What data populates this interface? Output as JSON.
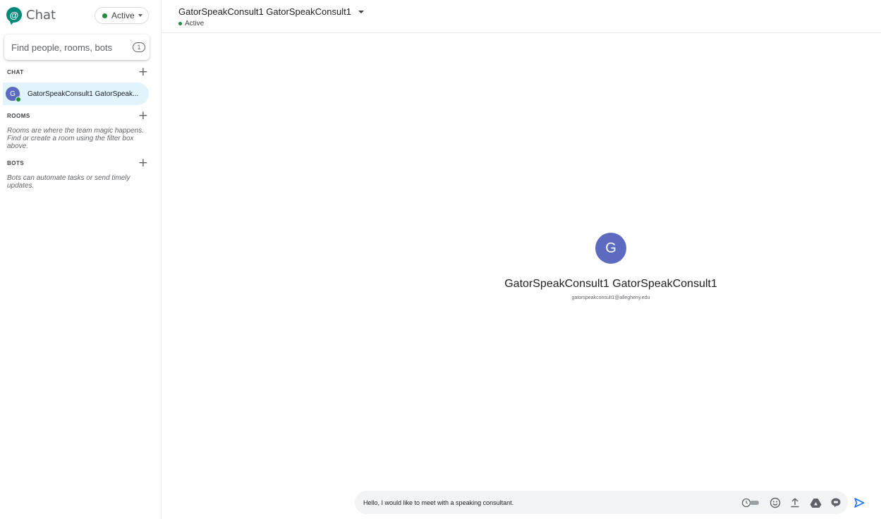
{
  "app": {
    "name": "Chat",
    "accent": "#00897b"
  },
  "status": {
    "label": "Active",
    "color": "#1e8e3e"
  },
  "search": {
    "placeholder": "Find people, rooms, bots",
    "badge": "1"
  },
  "sections": {
    "chat": {
      "title": "CHAT"
    },
    "rooms": {
      "title": "ROOMS",
      "hint": "Rooms are where the team magic happens. Find or create a room using the filter box above."
    },
    "bots": {
      "title": "BOTS",
      "hint": "Bots can automate tasks or send timely updates."
    }
  },
  "chat_items": [
    {
      "initial": "G",
      "label": "GatorSpeakConsult1 GatorSpeak..."
    }
  ],
  "conversation": {
    "title": "GatorSpeakConsult1 GatorSpeakConsult1",
    "status": "Active"
  },
  "profile": {
    "initial": "G",
    "name": "GatorSpeakConsult1 GatorSpeakConsult1",
    "email": "gatorspeakconsult1@allegheny.edu",
    "avatar_color": "#5c6bc0"
  },
  "composer": {
    "value": "Hello, I would like to meet with a speaking consultant.",
    "icons": [
      "history-toggle-icon",
      "emoji-icon",
      "upload-icon",
      "drive-icon",
      "meet-icon",
      "send-icon"
    ]
  }
}
